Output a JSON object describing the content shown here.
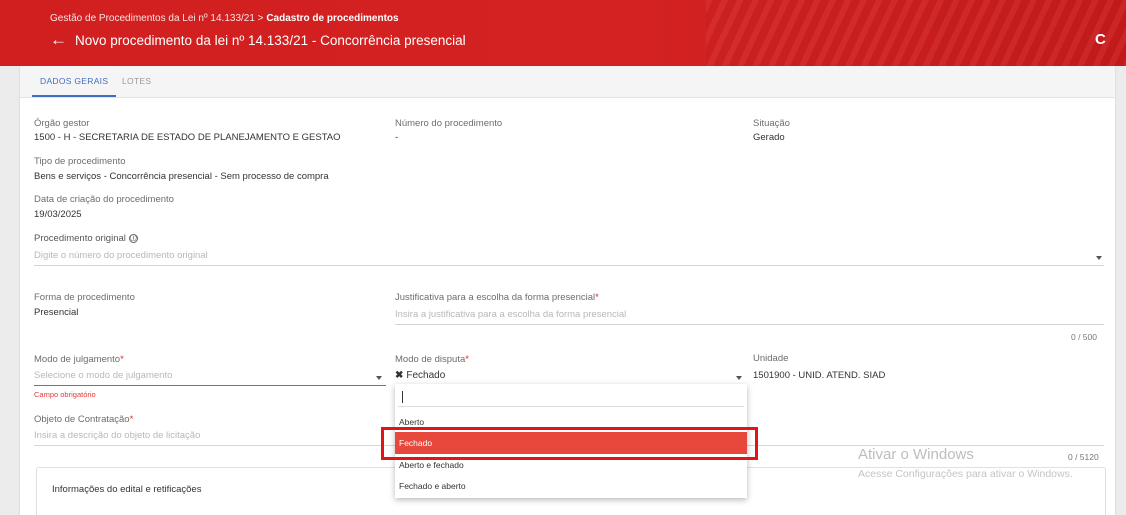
{
  "header": {
    "breadcrumb_parent": "Gestão de Procedimentos da Lei nº 14.133/21",
    "breadcrumb_separator": " > ",
    "breadcrumb_current": "Cadastro de procedimentos",
    "back_icon": "←",
    "title": "Novo procedimento da lei nº 14.133/21 - Concorrência presencial",
    "refresh_icon": "C"
  },
  "tabs": [
    {
      "label": "DADOS GERAIS",
      "active": true
    },
    {
      "label": "LOTES",
      "active": false
    }
  ],
  "fields": {
    "orgao_gestor": {
      "label": "Órgão gestor",
      "value": "1500 - H - SECRETARIA DE ESTADO DE PLANEJAMENTO E GESTAO"
    },
    "numero_procedimento": {
      "label": "Número do procedimento",
      "value": "-"
    },
    "situacao": {
      "label": "Situação",
      "value": "Gerado"
    },
    "tipo_procedimento": {
      "label": "Tipo de procedimento",
      "value": "Bens e serviços - Concorrência presencial - Sem processo de compra"
    },
    "data_criacao": {
      "label": "Data de criação do procedimento",
      "value": "19/03/2025"
    },
    "procedimento_original": {
      "label": "Procedimento original",
      "info_icon": "ⓘ",
      "placeholder": "Digite o número do procedimento original"
    },
    "forma_procedimento": {
      "label": "Forma de procedimento",
      "value": "Presencial"
    },
    "justificativa": {
      "label": "Justificativa para a escolha da forma presencial",
      "required_mark": "*",
      "placeholder": "Insira a justificativa para a escolha da forma presencial",
      "counter": "0 / 500"
    },
    "modo_julgamento": {
      "label": "Modo de julgamento",
      "required_mark": "*",
      "placeholder": "Selecione o modo de julgamento",
      "error": "Campo obrigatório"
    },
    "modo_disputa": {
      "label": "Modo de disputa",
      "required_mark": "*",
      "remove_icon": "✖",
      "value": "Fechado"
    },
    "unidade": {
      "label": "Unidade",
      "value": "1501900 - UNID. ATEND. SIAD"
    },
    "objeto_contratacao": {
      "label": "Objeto de Contratação",
      "required_mark": "*",
      "placeholder": "Insira a descrição do objeto de licitação",
      "counter": "0 / 5120"
    }
  },
  "dropdown": {
    "search_value": "",
    "options": [
      {
        "label": "Aberto",
        "selected": false
      },
      {
        "label": "Fechado",
        "selected": true
      },
      {
        "label": "Aberto e fechado",
        "selected": false
      },
      {
        "label": "Fechado e aberto",
        "selected": false
      }
    ]
  },
  "section": {
    "title": "Informações do edital e retificações"
  },
  "watermark": {
    "title": "Ativar o Windows",
    "subtitle": "Acesse Configurações para ativar o Windows."
  },
  "colors": {
    "header_red": "#d42222",
    "tab_active": "#3f6fc1",
    "selected_option": "#e8473c",
    "error": "#e53935",
    "highlight_box": "#e2141a"
  }
}
